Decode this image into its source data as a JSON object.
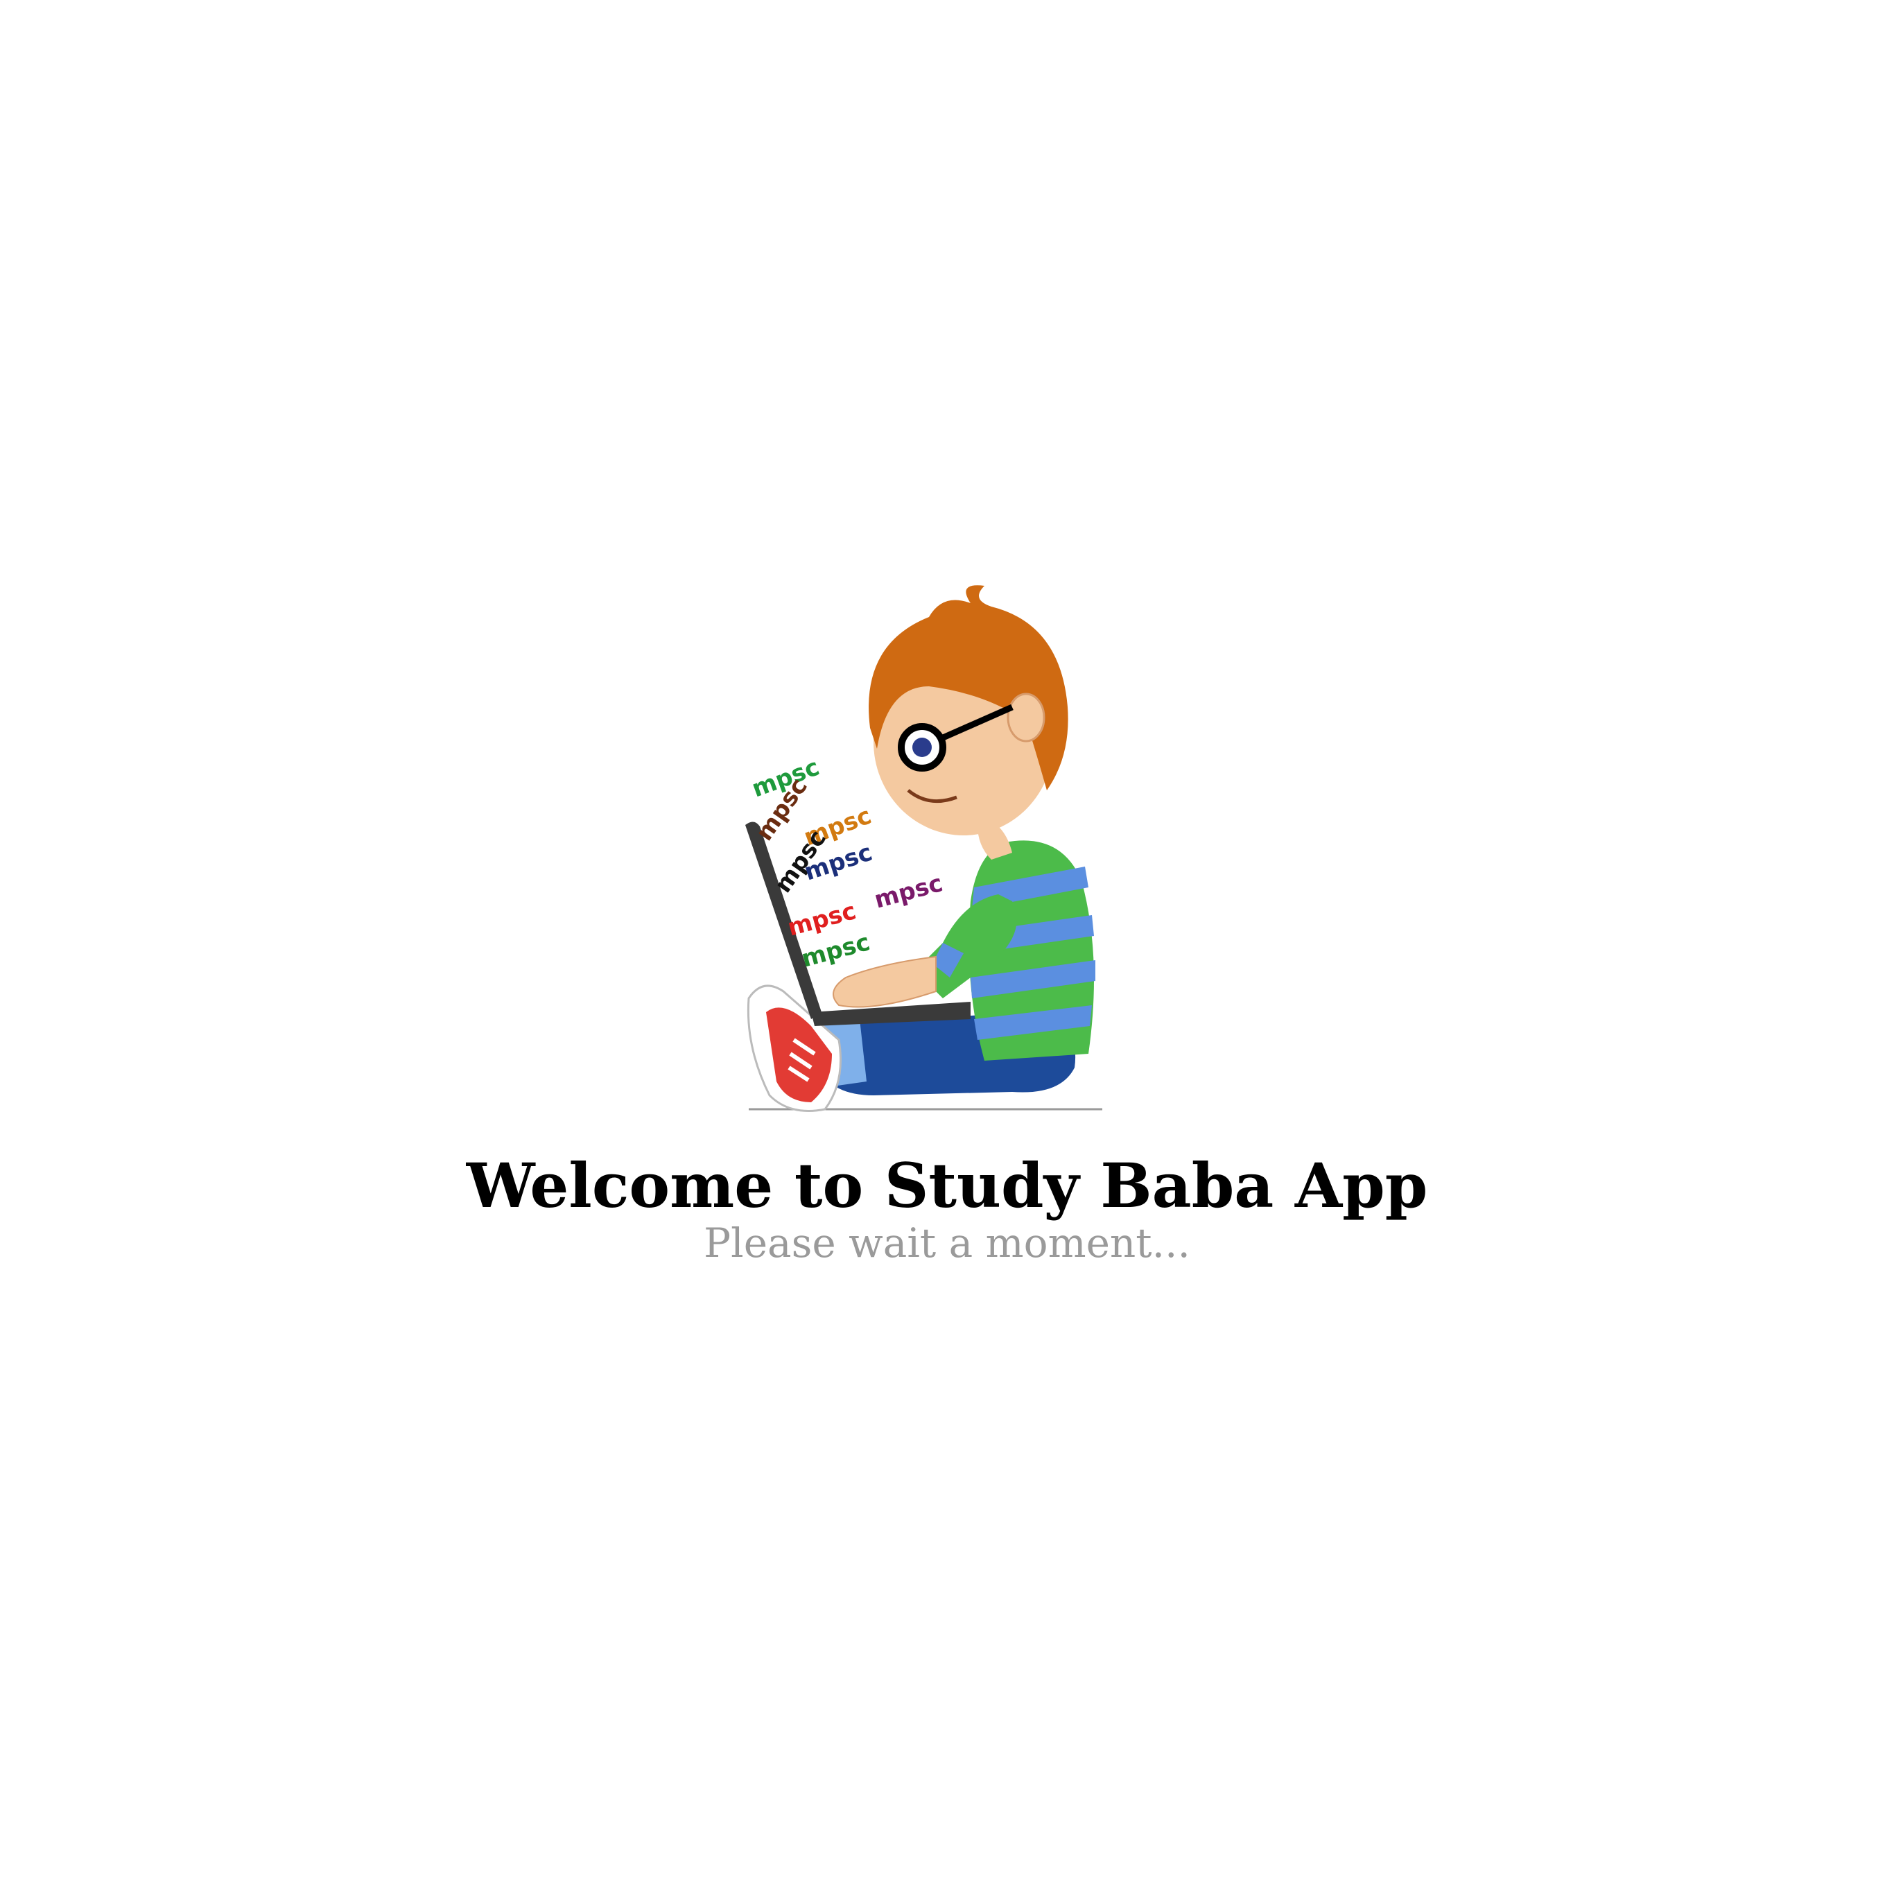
{
  "splash": {
    "illustration_icon": "boy-with-laptop-icon",
    "laptop_words": [
      "mpsc",
      "mpsc",
      "mpsc",
      "mpsc",
      "mpsc",
      "mpsc",
      "mpsc",
      "mpsc"
    ],
    "title": "Welcome to Study Baba App",
    "subtitle": "Please wait a moment..."
  },
  "colors": {
    "background": "#ffffff",
    "title": "#000000",
    "subtitle": "#9a9a9a",
    "hair": "#cf6a12",
    "shirt_green": "#4cbb4a",
    "shirt_blue": "#5b8fe0",
    "jeans": "#1d4b9a",
    "shoe_red": "#e23b34",
    "laptop": "#3a3a3a"
  }
}
